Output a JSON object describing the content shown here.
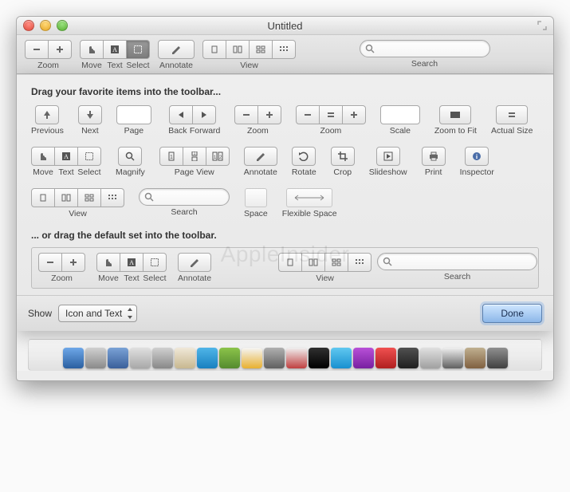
{
  "window": {
    "title": "Untitled"
  },
  "toolbar": {
    "zoom": "Zoom",
    "move": "Move",
    "text": "Text",
    "select": "Select",
    "annotate": "Annotate",
    "view": "View",
    "search": "Search"
  },
  "sheet": {
    "instruction1": "Drag your favorite items into the toolbar...",
    "instruction2": "... or drag the default set into the toolbar.",
    "items": {
      "previous": "Previous",
      "next": "Next",
      "page": "Page",
      "back": "Back",
      "forward": "Forward",
      "zoom": "Zoom",
      "zoom3": "Zoom",
      "scale": "Scale",
      "zoom_to_fit": "Zoom to Fit",
      "actual_size": "Actual Size",
      "move": "Move",
      "text": "Text",
      "select": "Select",
      "magnify": "Magnify",
      "page_view": "Page View",
      "annotate": "Annotate",
      "rotate": "Rotate",
      "crop": "Crop",
      "slideshow": "Slideshow",
      "print": "Print",
      "inspector": "Inspector",
      "view": "View",
      "search": "Search",
      "space": "Space",
      "flexible_space": "Flexible Space"
    },
    "default_set": {
      "zoom": "Zoom",
      "move": "Move",
      "text": "Text",
      "select": "Select",
      "annotate": "Annotate",
      "view": "View",
      "search": "Search"
    }
  },
  "footer": {
    "show_label": "Show",
    "show_value": "Icon and Text",
    "done": "Done"
  },
  "watermark": "AppleInsider"
}
